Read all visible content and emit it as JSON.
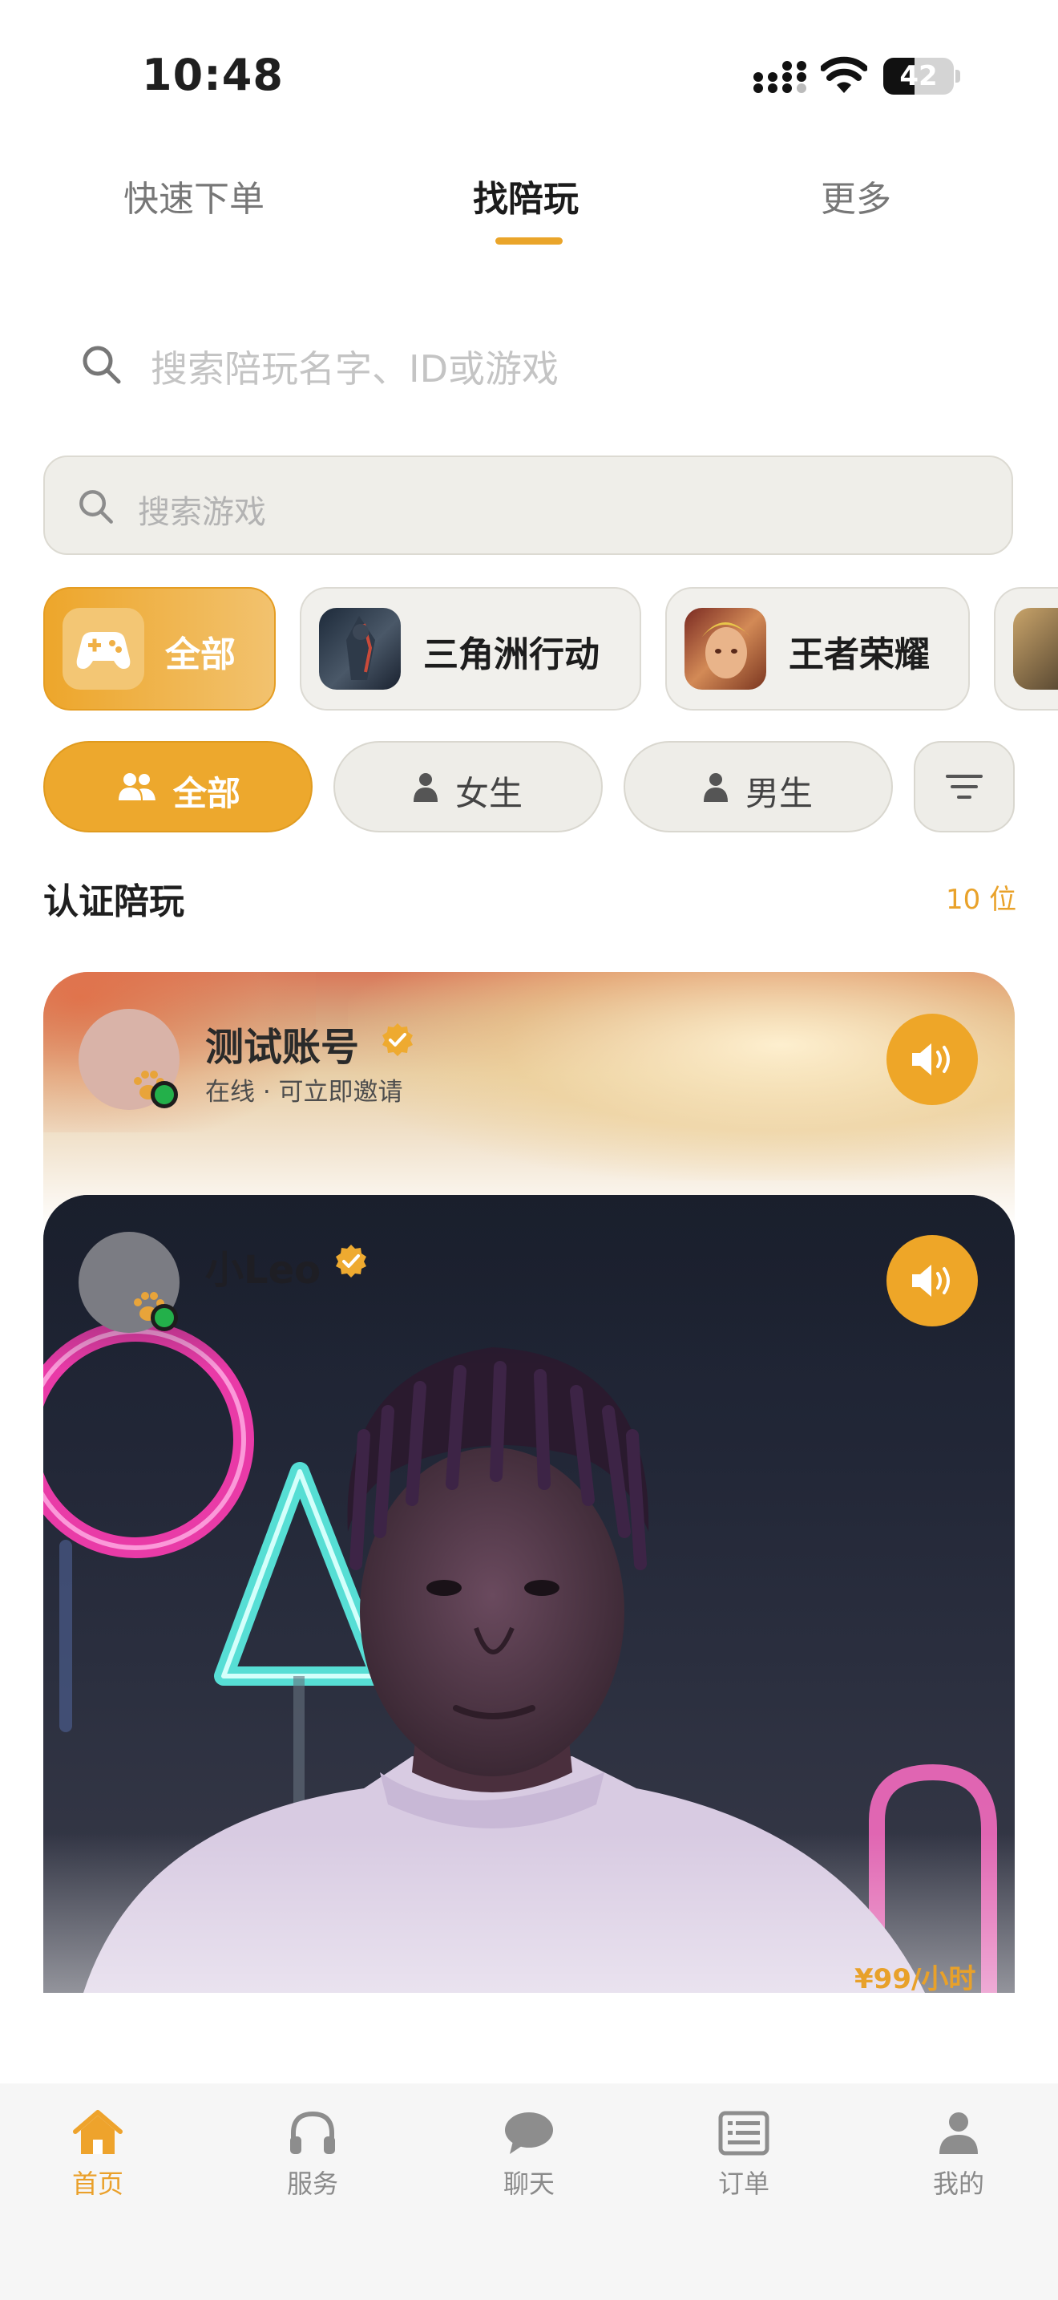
{
  "status_bar": {
    "time": "10:48",
    "battery": "42"
  },
  "top_tabs": [
    {
      "label": "快速下单"
    },
    {
      "label": "找陪玩"
    },
    {
      "label": "更多"
    }
  ],
  "search": {
    "main_placeholder": "搜索陪玩名字、ID或游戏",
    "game_placeholder": "搜索游戏"
  },
  "game_chips": [
    {
      "label": "全部",
      "icon": "gamepad-icon"
    },
    {
      "label": "三角洲行动"
    },
    {
      "label": "王者荣耀"
    }
  ],
  "gender_filters": [
    {
      "label": "全部",
      "icon": "group-icon"
    },
    {
      "label": "女生",
      "icon": "person-icon"
    },
    {
      "label": "男生",
      "icon": "person-icon"
    }
  ],
  "section": {
    "title": "认证陪玩",
    "count": "10 位"
  },
  "cards": [
    {
      "name": "测试账号",
      "status": "在线 · 可立即邀请"
    },
    {
      "name": "小Leo",
      "price": "¥99/小时"
    }
  ],
  "bottom_nav": [
    {
      "label": "首页",
      "icon": "home-icon"
    },
    {
      "label": "服务",
      "icon": "headphones-icon"
    },
    {
      "label": "聊天",
      "icon": "chat-bubble-icon"
    },
    {
      "label": "订单",
      "icon": "order-list-icon"
    },
    {
      "label": "我的",
      "icon": "profile-icon"
    }
  ],
  "colors": {
    "accent": "#eda82d",
    "online": "#23b04a",
    "nav_bg": "#f6f6f6"
  }
}
